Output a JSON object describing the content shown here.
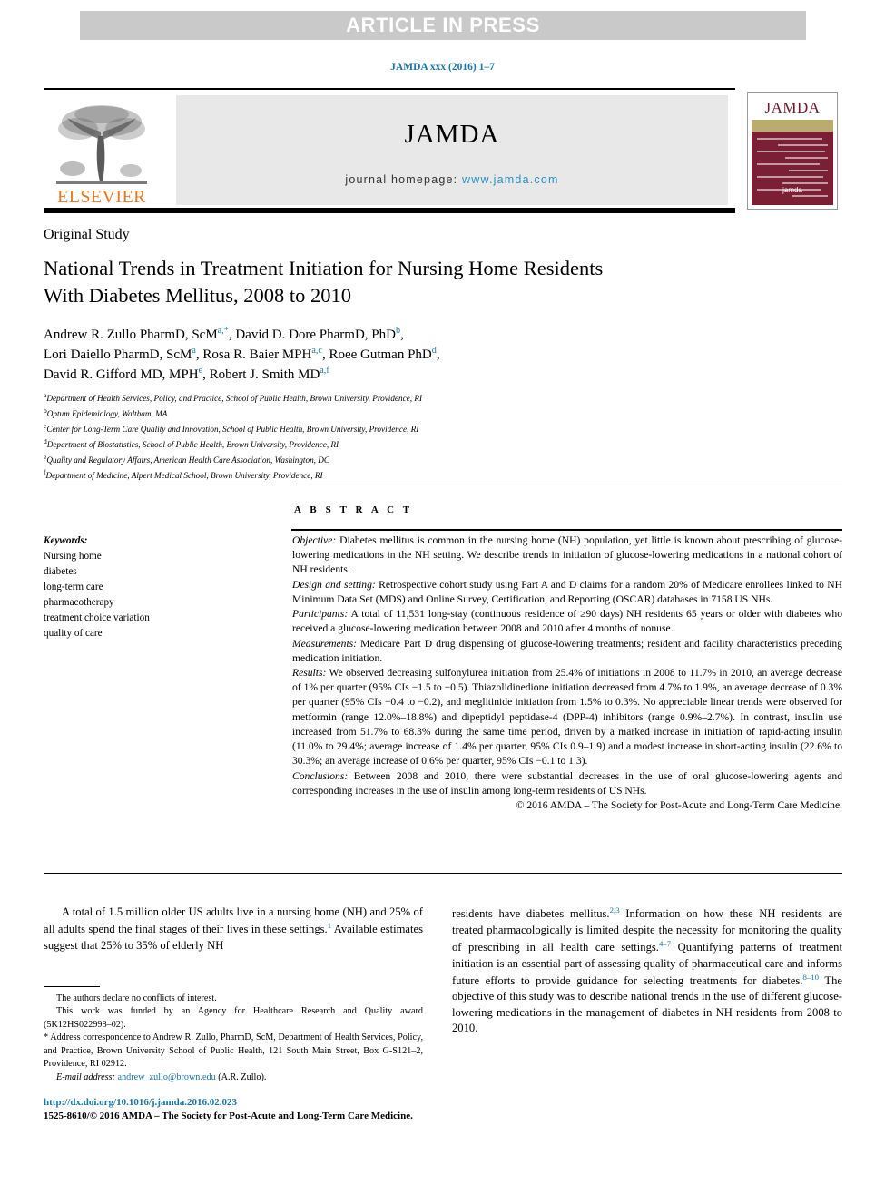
{
  "header": {
    "banner": "ARTICLE IN PRESS",
    "citation": "JAMDA xxx (2016) 1–7",
    "publisher_name": "ELSEVIER",
    "journal_wordmark": "JAMDA",
    "homepage_label": "journal homepage:",
    "homepage_url": "www.jamda.com",
    "cover_title": "JAMDA",
    "cover_logo": "jamda"
  },
  "article": {
    "section_label": "Original Study",
    "title_line1": "National Trends in Treatment Initiation for Nursing Home Residents",
    "title_line2": "With Diabetes Mellitus, 2008 to 2010"
  },
  "authors": {
    "line1": "Andrew R. Zullo PharmD, ScM",
    "line1_sup": "a,*",
    "line1b": ", David D. Dore PharmD, PhD",
    "line1b_sup": "b",
    "line1c": ",",
    "line2": "Lori Daiello PharmD, ScM",
    "line2_sup": "a",
    "line2b": ", Rosa R. Baier MPH",
    "line2b_sup": "a,c",
    "line2c": ", Roee Gutman PhD",
    "line2c_sup": "d",
    "line2d": ",",
    "line3": "David R. Gifford MD, MPH",
    "line3_sup": "e",
    "line3b": ", Robert J. Smith MD",
    "line3b_sup": "a,f"
  },
  "affiliations": [
    {
      "marker": "a",
      "text": "Department of Health Services, Policy, and Practice, School of Public Health, Brown University, Providence, RI"
    },
    {
      "marker": "b",
      "text": "Optum Epidemiology, Waltham, MA"
    },
    {
      "marker": "c",
      "text": "Center for Long-Term Care Quality and Innovation, School of Public Health, Brown University, Providence, RI"
    },
    {
      "marker": "d",
      "text": "Department of Biostatistics, School of Public Health, Brown University, Providence, RI"
    },
    {
      "marker": "e",
      "text": "Quality and Regulatory Affairs, American Health Care Association, Washington, DC"
    },
    {
      "marker": "f",
      "text": "Department of Medicine, Alpert Medical School, Brown University, Providence, RI"
    }
  ],
  "keywords": {
    "heading": "Keywords:",
    "items": [
      "Nursing home",
      "diabetes",
      "long-term care",
      "pharmacotherapy",
      "treatment choice variation",
      "quality of care"
    ]
  },
  "abstract": {
    "heading": "A B S T R A C T",
    "objective_label": "Objective:",
    "objective_text": " Diabetes mellitus is common in the nursing home (NH) population, yet little is known about prescribing of glucose-lowering medications in the NH setting. We describe trends in initiation of glucose-lowering medications in a national cohort of NH residents.",
    "design_label": "Design and setting:",
    "design_text": " Retrospective cohort study using Part A and D claims for a random 20% of Medicare enrollees linked to NH Minimum Data Set (MDS) and Online Survey, Certification, and Reporting (OSCAR) databases in 7158 US NHs.",
    "participants_label": "Participants:",
    "participants_text": " A total of 11,531 long-stay (continuous residence of ≥90 days) NH residents 65 years or older with diabetes who received a glucose-lowering medication between 2008 and 2010 after 4 months of nonuse.",
    "measurements_label": "Measurements:",
    "measurements_text": " Medicare Part D drug dispensing of glucose-lowering treatments; resident and facility characteristics preceding medication initiation.",
    "results_label": "Results:",
    "results_text": " We observed decreasing sulfonylurea initiation from 25.4% of initiations in 2008 to 11.7% in 2010, an average decrease of 1% per quarter (95% CIs −1.5 to −0.5). Thiazolidinedione initiation decreased from 4.7% to 1.9%, an average decrease of 0.3% per quarter (95% CIs −0.4 to −0.2), and meglitinide initiation from 1.5% to 0.3%. No appreciable linear trends were observed for metformin (range 12.0%–18.8%) and dipeptidyl peptidase-4 (DPP-4) inhibitors (range 0.9%–2.7%). In contrast, insulin use increased from 51.7% to 68.3% during the same time period, driven by a marked increase in initiation of rapid-acting insulin (11.0% to 29.4%; average increase of 1.4% per quarter, 95% CIs 0.9–1.9) and a modest increase in short-acting insulin (22.6% to 30.3%; an average increase of 0.6% per quarter, 95% CIs −0.1 to 1.3).",
    "conclusions_label": "Conclusions:",
    "conclusions_text": " Between 2008 and 2010, there were substantial decreases in the use of oral glucose-lowering agents and corresponding increases in the use of insulin among long-term residents of US NHs.",
    "copyright": "© 2016 AMDA – The Society for Post-Acute and Long-Term Care Medicine."
  },
  "body": {
    "left_para_part1": "A total of 1.5 million older US adults live in a nursing home (NH) and 25% of all adults spend the final stages of their lives in these settings.",
    "left_ref1": "1",
    "left_para_part2": " Available estimates suggest that 25% to 35% of elderly NH",
    "right_part1": "residents have diabetes mellitus.",
    "right_ref1": "2,3",
    "right_part2": " Information on how these NH residents are treated pharmacologically is limited despite the necessity for monitoring the quality of prescribing in all health care settings.",
    "right_ref2": "4–7",
    "right_part3": " Quantifying patterns of treatment initiation is an essential part of assessing quality of pharmaceutical care and informs future efforts to provide guidance for selecting treatments for diabetes.",
    "right_ref3": "8–10",
    "right_part4": " The objective of this study was to describe national trends in the use of different glucose-lowering medications in the management of diabetes in NH residents from 2008 to 2010."
  },
  "footnotes": {
    "conflicts": "The authors declare no conflicts of interest.",
    "funding": "This work was funded by an Agency for Healthcare Research and Quality award (5K12HS022998–02).",
    "correspondence_marker": "*",
    "correspondence": " Address correspondence to Andrew R. Zullo, PharmD, ScM, Department of Health Services, Policy, and Practice, Brown University School of Public Health, 121 South Main Street, Box G-S121–2, Providence, RI 02912.",
    "email_label": "E-mail address:",
    "email": "andrew_zullo@brown.edu",
    "email_suffix": " (A.R. Zullo)."
  },
  "footer": {
    "doi": "http://dx.doi.org/10.1016/j.jamda.2016.02.023",
    "issn": "1525-8610/© 2016 AMDA – The Society for Post-Acute and Long-Term Care Medicine."
  },
  "colors": {
    "link_blue": "#1b76a8",
    "elsevier_orange": "#e87722",
    "banner_grey": "#c9c9c9",
    "cover_maroon": "#7b1f35",
    "cover_band": "#b9ac6e"
  }
}
